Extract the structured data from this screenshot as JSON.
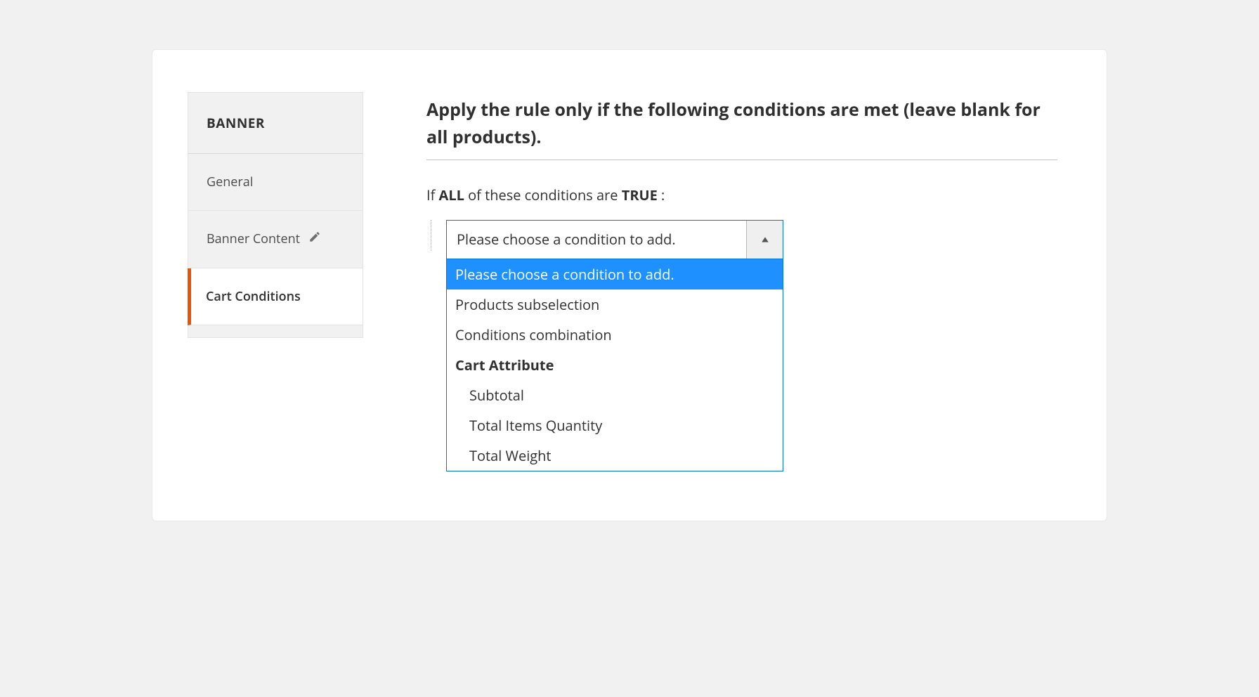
{
  "sidebar": {
    "header": "BANNER",
    "items": [
      {
        "label": "General",
        "active": false,
        "edit_icon": false
      },
      {
        "label": "Banner Content",
        "active": false,
        "edit_icon": true
      },
      {
        "label": "Cart Conditions",
        "active": true,
        "edit_icon": false
      }
    ]
  },
  "main": {
    "heading": "Apply the rule only if the following conditions are met (leave blank for all products).",
    "sentence": {
      "pre": "If ",
      "aggregate": "ALL",
      "mid": " of these conditions are ",
      "value": "TRUE",
      "post": " :"
    },
    "select": {
      "placeholder": "Please choose a condition to add.",
      "options": [
        {
          "label": "Please choose a condition to add.",
          "highlight": true,
          "type": "option"
        },
        {
          "label": "Products subselection",
          "type": "option"
        },
        {
          "label": "Conditions combination",
          "type": "option"
        },
        {
          "label": "Cart Attribute",
          "type": "group"
        },
        {
          "label": "Subtotal",
          "type": "child"
        },
        {
          "label": "Total Items Quantity",
          "type": "child"
        },
        {
          "label": "Total Weight",
          "type": "child"
        }
      ]
    }
  }
}
